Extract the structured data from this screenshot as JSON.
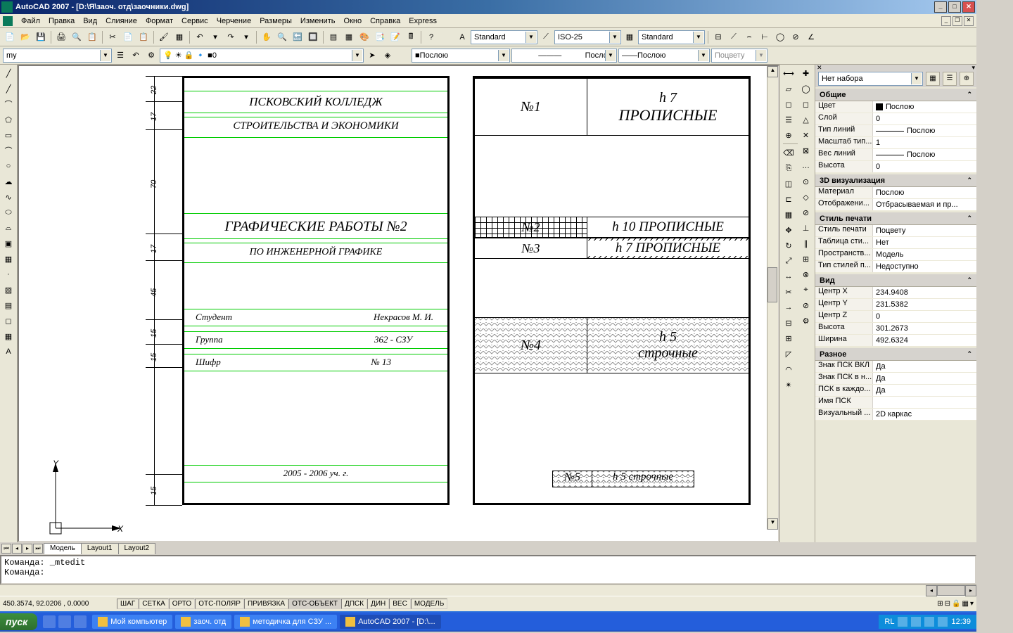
{
  "title": "AutoCAD 2007 - [D:\\Я\\заоч. отд\\заочники.dwg]",
  "menu": [
    "Файл",
    "Правка",
    "Вид",
    "Слияние",
    "Формат",
    "Сервис",
    "Черчение",
    "Размеры",
    "Изменить",
    "Окно",
    "Справка",
    "Express"
  ],
  "row2": {
    "layer_combo": "my",
    "layer_state": "0",
    "textstyle": "Standard",
    "dimstyle": "ISO-25",
    "tablestyle": "Standard"
  },
  "row3": {
    "color": "Послою",
    "linetype": "Послою",
    "lineweight": "Послою",
    "plotstyle": "Поцвету"
  },
  "props": {
    "selection": "Нет набора",
    "groups": [
      {
        "name": "Общие",
        "rows": [
          {
            "k": "Цвет",
            "v": "Послою",
            "swatch": "#000"
          },
          {
            "k": "Слой",
            "v": "0"
          },
          {
            "k": "Тип линий",
            "v": "Послою",
            "line": true
          },
          {
            "k": "Масштаб тип...",
            "v": "1"
          },
          {
            "k": "Вес линий",
            "v": "Послою",
            "line": true
          },
          {
            "k": "Высота",
            "v": "0"
          }
        ]
      },
      {
        "name": "3D визуализация",
        "rows": [
          {
            "k": "Материал",
            "v": "Послою"
          },
          {
            "k": "Отображени...",
            "v": "Отбрасываемая и пр..."
          }
        ]
      },
      {
        "name": "Стиль печати",
        "rows": [
          {
            "k": "Стиль печати",
            "v": "Поцвету"
          },
          {
            "k": "Таблица сти...",
            "v": "Нет"
          },
          {
            "k": "Пространств...",
            "v": "Модель"
          },
          {
            "k": "Тип стилей п...",
            "v": "Недоступно"
          }
        ]
      },
      {
        "name": "Вид",
        "rows": [
          {
            "k": "Центр X",
            "v": "234.9408"
          },
          {
            "k": "Центр Y",
            "v": "231.5382"
          },
          {
            "k": "Центр Z",
            "v": "0"
          },
          {
            "k": "Высота",
            "v": "301.2673"
          },
          {
            "k": "Ширина",
            "v": "492.6324"
          }
        ]
      },
      {
        "name": "Разное",
        "rows": [
          {
            "k": "Знак ПСК ВКЛ",
            "v": "Да"
          },
          {
            "k": "Знак ПСК в н...",
            "v": "Да"
          },
          {
            "k": "ПСК в каждо...",
            "v": "Да"
          },
          {
            "k": "Имя ПСК",
            "v": ""
          },
          {
            "k": "Визуальный ...",
            "v": "2D каркас"
          }
        ]
      }
    ]
  },
  "tabs": {
    "items": [
      "Модель",
      "Layout1",
      "Layout2"
    ],
    "active": 0
  },
  "cmd": {
    "line1": "Команда: _mtedit",
    "line2": "Команда:"
  },
  "status": {
    "coords": "450.3574, 92.0206 , 0.0000",
    "btns": [
      "ШАГ",
      "СЕТКА",
      "ОРТО",
      "ОТС-ПОЛЯР",
      "ПРИВЯЗКА",
      "ОТС-ОБЪЕКТ",
      "ДПСК",
      "ДИН",
      "ВЕС",
      "МОДЕЛЬ"
    ],
    "lang": "RL"
  },
  "taskbar": {
    "start": "пуск",
    "items": [
      {
        "t": "Мой компьютер",
        "a": false
      },
      {
        "t": "заоч. отд",
        "a": false
      },
      {
        "t": "методичка для СЗУ ...",
        "a": false
      },
      {
        "t": "AutoCAD 2007 - [D:\\...",
        "a": true
      }
    ],
    "time": "12:39"
  },
  "doc1": {
    "l1": "ПСКОВСКИЙ КОЛЛЕДЖ",
    "l2": "СТРОИТЕЛЬСТВА И ЭКОНОМИКИ",
    "l3": "ГРАФИЧЕСКИЕ РАБОТЫ №2",
    "l4": "ПО ИНЖЕНЕРНОЙ ГРАФИКЕ",
    "s1k": "Студент",
    "s1v": "Некрасов М. И.",
    "s2k": "Группа",
    "s2v": "362 - СЗУ",
    "s3k": "Шифр",
    "s3v": "№ 13",
    "yr": "2005 - 2006 уч. г.",
    "dims": [
      "22",
      "17",
      "70",
      "17",
      "45",
      "15",
      "15",
      "15"
    ]
  },
  "doc2": {
    "r1": {
      "n": "№1",
      "t1": "h 7",
      "t2": "ПРОПИСНЫЕ"
    },
    "r2": {
      "n": "№2",
      "t": "h 10  ПРОПИСНЫЕ"
    },
    "r3": {
      "n": "№3",
      "t": "h 7   ПРОПИСНЫЕ"
    },
    "r4": {
      "n": "№4",
      "t1": "h 5",
      "t2": "строчные"
    },
    "r5": {
      "n": "№5",
      "t": "h 5  строчные"
    }
  },
  "ucs": {
    "y": "Y",
    "x": "X"
  }
}
